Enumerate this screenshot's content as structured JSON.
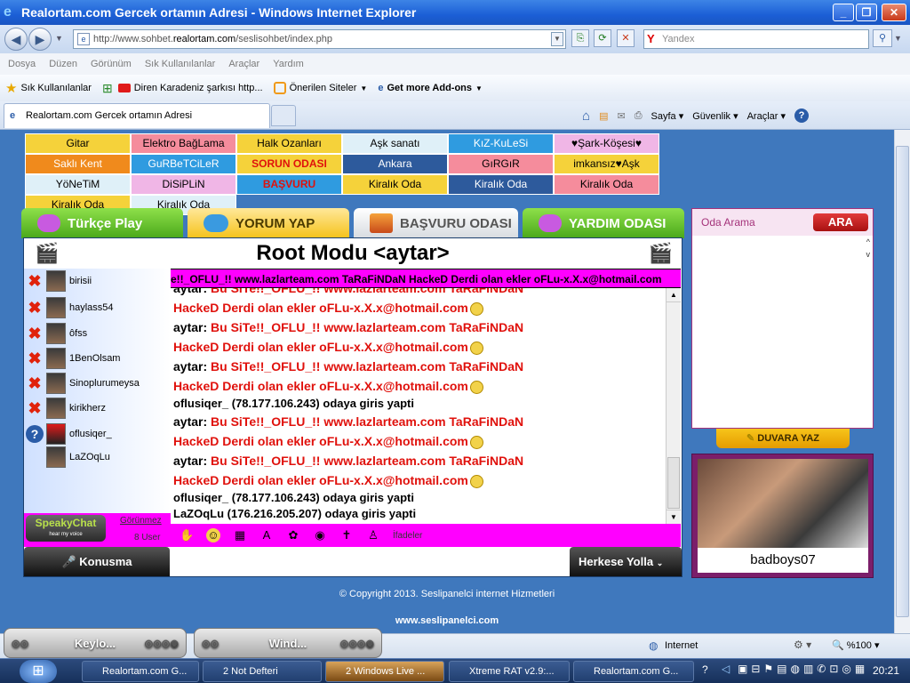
{
  "window": {
    "title": "Realortam.com Gercek ortamın Adresi - Windows Internet Explorer"
  },
  "navbar": {
    "address_host_prefix": "http://www.sohbet.",
    "address_host": "realortam.com",
    "address_path": "/seslisohbet/index.php",
    "search_placeholder": "Yandex",
    "search_logo": "Y"
  },
  "menubar": [
    "Dosya",
    "Düzen",
    "Görünüm",
    "Sık Kullanılanlar",
    "Araçlar",
    "Yardım"
  ],
  "favbar": {
    "favorites": "Sık Kullanılanlar",
    "items": [
      "Diren Karadeniz şarkısı  http...",
      "Önerilen Siteler",
      "Get more Add-ons"
    ]
  },
  "tabbar": {
    "active_tab": "Realortam.com Gercek ortamın Adresi",
    "commands": [
      "Sayfa",
      "Güvenlik",
      "Araçlar"
    ]
  },
  "rooms": [
    {
      "label": "Gitar",
      "bg": "#f5d23a",
      "fg": "#000"
    },
    {
      "label": "Elektro BağLama",
      "bg": "#f58c9c",
      "fg": "#000"
    },
    {
      "label": "Halk Ozanları",
      "bg": "#f5d23a",
      "fg": "#000"
    },
    {
      "label": "Aşk sanatı",
      "bg": "#dff0f8",
      "fg": "#000"
    },
    {
      "label": "KıZ-KuLeSi",
      "bg": "#2f9be0",
      "fg": "#fff"
    },
    {
      "label": "♥Şark-Köşesi♥",
      "bg": "#f0b6e6",
      "fg": "#000"
    },
    {
      "label": "Saklı Kent",
      "bg": "#f08a1c",
      "fg": "#fff"
    },
    {
      "label": "GuRBeTCiLeR",
      "bg": "#2f9be0",
      "fg": "#fff"
    },
    {
      "label": "SORUN ODASI",
      "bg": "#f5d23a",
      "fg": "#e0110c"
    },
    {
      "label": "Ankara",
      "bg": "#2d5a9c",
      "fg": "#fff"
    },
    {
      "label": "GıRGıR",
      "bg": "#f58c9c",
      "fg": "#000"
    },
    {
      "label": "imkansız♥Aşk",
      "bg": "#f5d23a",
      "fg": "#000"
    },
    {
      "label": "YöNeTiM",
      "bg": "#dff0f8",
      "fg": "#000"
    },
    {
      "label": "DiSiPLiN",
      "bg": "#f0b6e6",
      "fg": "#000"
    },
    {
      "label": "BAŞVURU",
      "bg": "#2f9be0",
      "fg": "#e0110c"
    },
    {
      "label": "Kiralık Oda",
      "bg": "#f5d23a",
      "fg": "#000"
    },
    {
      "label": "Kiralık Oda",
      "bg": "#2d5a9c",
      "fg": "#fff"
    },
    {
      "label": "Kiralık Oda",
      "bg": "#f58c9c",
      "fg": "#000"
    },
    {
      "label": "Kiralık Oda",
      "bg": "#f5d23a",
      "fg": "#000"
    },
    {
      "label": "Kiralık Oda",
      "bg": "#dff0f8",
      "fg": "#000"
    }
  ],
  "tabs": {
    "play": "Türkçe Play",
    "comment": "YORUM YAP",
    "apply": "BAŞVURU ODASI",
    "help": "YARDIM ODASI"
  },
  "chat": {
    "room_title": "Root Modu <aytar>",
    "marquee": "e!!_OFLU_!! www.lazlarteam.com TaRaFiNDaN HackeD Derdi olan ekler oFLu-x.X.x@hotmail.com",
    "users": [
      {
        "name": "birisii",
        "status": "x"
      },
      {
        "name": "haylass54",
        "status": "x"
      },
      {
        "name": "ôfss",
        "status": "x"
      },
      {
        "name": "1BenOlsam",
        "status": "x"
      },
      {
        "name": "Sinoplurumeysa",
        "status": "x"
      },
      {
        "name": "kirikherz",
        "status": "x"
      },
      {
        "name": "oflusiqer_",
        "status": "?"
      },
      {
        "name": "LaZOqLu",
        "status": ""
      }
    ],
    "log": [
      {
        "speaker": "aytar:",
        "text": "Bu SiTe!!_OFLU_!! www.lazlarteam.com TaRaFiNDaN"
      },
      {
        "speaker": "",
        "text": "HackeD Derdi olan ekler oFLu-x.X.x@hotmail.com"
      },
      {
        "speaker": "aytar:",
        "text": "Bu SiTe!!_OFLU_!! www.lazlarteam.com TaRaFiNDaN"
      },
      {
        "speaker": "",
        "text": "HackeD Derdi olan ekler oFLu-x.X.x@hotmail.com"
      },
      {
        "speaker": "aytar:",
        "text": "Bu SiTe!!_OFLU_!! www.lazlarteam.com TaRaFiNDaN"
      },
      {
        "speaker": "",
        "text": "HackeD Derdi olan ekler oFLu-x.X.x@hotmail.com"
      },
      {
        "system": "oflusiqer_ (78.177.106.243) odaya giris yapti"
      },
      {
        "speaker": "aytar:",
        "text": "Bu SiTe!!_OFLU_!! www.lazlarteam.com TaRaFiNDaN"
      },
      {
        "speaker": "",
        "text": "HackeD Derdi olan ekler oFLu-x.X.x@hotmail.com"
      },
      {
        "speaker": "aytar:",
        "text": "Bu SiTe!!_OFLU_!! www.lazlarteam.com TaRaFiNDaN"
      },
      {
        "speaker": "",
        "text": "HackeD Derdi olan ekler oFLu-x.X.x@hotmail.com"
      },
      {
        "system": "oflusiqer_ (78.177.106.243) odaya giris yapti"
      },
      {
        "system": "LaZOqLu (176.216.205.207) odaya giris yapti"
      }
    ],
    "speaky_logo": "SpeakyChat",
    "speaky_tagline": "hear my voice",
    "visibility_link": "Görünmez",
    "user_count": "8 User",
    "emoticons_label": "İfadeler",
    "talk_button": "Konusma",
    "audience_select": "Herkese Yolla"
  },
  "right_panel": {
    "room_search_label": "Oda Arama",
    "search_button": "ARA",
    "wall_button": "DUVARA YAZ",
    "profile_name": "badboys07"
  },
  "footer": {
    "copyright": "© Copyright 2013. Seslipanelci internet Hizmetleri",
    "site": "www.seslipanelci.com"
  },
  "statusbar": {
    "zone": "Internet",
    "zoom": "%100"
  },
  "desktop_boxes": [
    "Keylo...",
    "Wind..."
  ],
  "taskbar": {
    "tasks": [
      {
        "label": "Realortam.com G...",
        "active": false
      },
      {
        "label": "2 Not Defteri",
        "active": false
      },
      {
        "label": "2 Windows Live ...",
        "active": true
      },
      {
        "label": "Xtreme RAT v2.9:...",
        "active": false
      },
      {
        "label": "Realortam.com G...",
        "active": false
      }
    ],
    "clock": "20:21"
  }
}
